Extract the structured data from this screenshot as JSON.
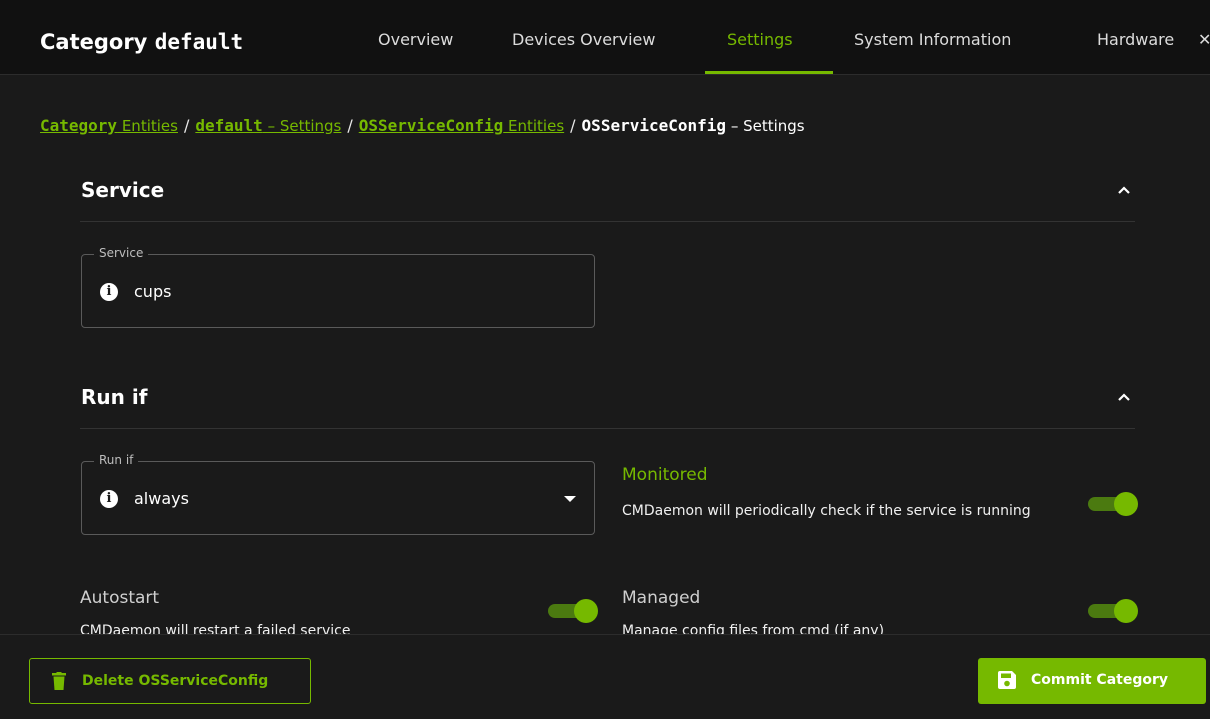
{
  "header": {
    "title_prefix": "Category ",
    "title_name": "default",
    "tabs": [
      {
        "label": "Overview",
        "active": false
      },
      {
        "label": "Devices Overview",
        "active": false
      },
      {
        "label": "Settings",
        "active": true
      },
      {
        "label": "System Information",
        "active": false
      },
      {
        "label": "Hardware",
        "active": false
      }
    ]
  },
  "breadcrumb": {
    "items": [
      {
        "name": "Category",
        "suffix": " Entities"
      },
      {
        "name": "default",
        "suffix": " – Settings"
      },
      {
        "name": "OSServiceConfig",
        "suffix": " Entities"
      }
    ],
    "current": {
      "name": "OSServiceConfig",
      "suffix": " – Settings"
    },
    "separator": "/"
  },
  "sections": {
    "service": {
      "title": "Service",
      "field": {
        "legend": "Service",
        "value": "cups"
      }
    },
    "run_if": {
      "title": "Run if",
      "field": {
        "legend": "Run if",
        "value": "always"
      },
      "monitored": {
        "label": "Monitored",
        "description": "CMDaemon will periodically check if the service is running",
        "enabled": true
      },
      "autostart": {
        "label": "Autostart",
        "description": "CMDaemon will restart a failed service",
        "enabled": true
      },
      "managed": {
        "label": "Managed",
        "description": "Manage config files from cmd (if any)",
        "enabled": true
      }
    }
  },
  "actions": {
    "delete_label": "Delete OSServiceConfig",
    "commit_label": "Commit Category"
  },
  "colors": {
    "accent": "#76b900",
    "background": "#1a1a1a",
    "header_background": "#111111"
  }
}
